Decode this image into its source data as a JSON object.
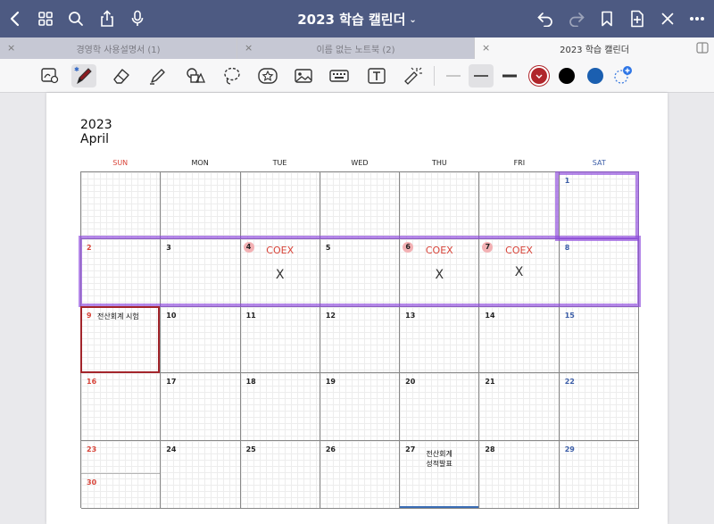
{
  "nav": {
    "title": "2023 학습 캘린더"
  },
  "tabs": [
    {
      "label": "경영학 사용설명서 (1)"
    },
    {
      "label": "이름 없는 노트북 (2)"
    },
    {
      "label": "2023 학습 캘린더"
    }
  ],
  "toolbar": {
    "colors": [
      "#b0262b",
      "#000000",
      "#1b5fb0"
    ]
  },
  "calendar": {
    "year": "2023",
    "month": "April",
    "weekdays": [
      "SUN",
      "MON",
      "TUE",
      "WED",
      "THU",
      "FRI",
      "SAT"
    ],
    "weeks": [
      [
        "",
        "",
        "",
        "",
        "",
        "",
        "1"
      ],
      [
        "2",
        "3",
        "4",
        "5",
        "6",
        "7",
        "8"
      ],
      [
        "9",
        "10",
        "11",
        "12",
        "13",
        "14",
        "15"
      ],
      [
        "16",
        "17",
        "18",
        "19",
        "20",
        "21",
        "22"
      ],
      [
        "23",
        "24",
        "25",
        "26",
        "27",
        "28",
        "29"
      ]
    ],
    "extra_day": "30",
    "events": {
      "tue_4": "COEX",
      "thu_6": "COEX",
      "fri_7": "COEX",
      "mark": "X",
      "sun_9": "전산회계 시험",
      "thu_27": "전산회계\n성적발표"
    }
  }
}
